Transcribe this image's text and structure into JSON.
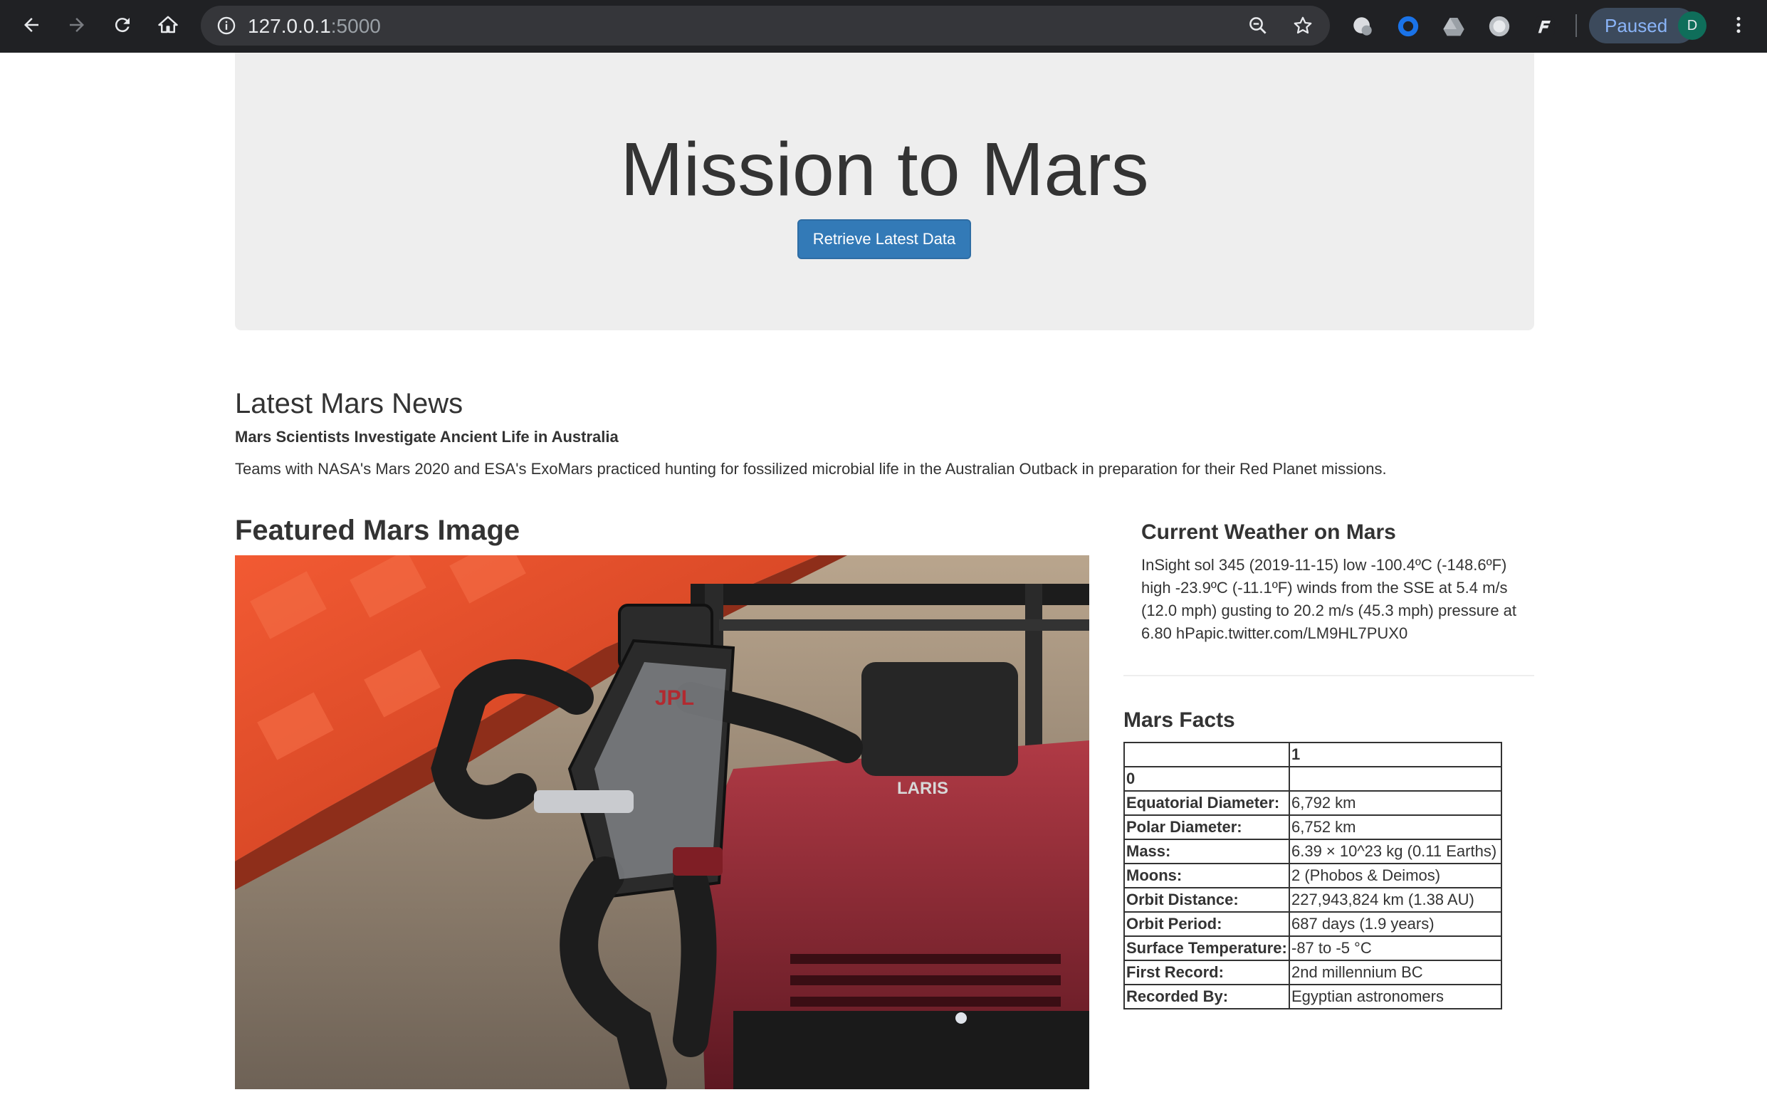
{
  "browser": {
    "url_host": "127.0.0.1",
    "url_port": ":5000",
    "profile_status": "Paused",
    "avatar_initial": "D"
  },
  "jumbotron": {
    "title": "Mission to Mars",
    "button_label": "Retrieve Latest Data"
  },
  "news": {
    "heading": "Latest Mars News",
    "title": "Mars Scientists Investigate Ancient Life in Australia",
    "paragraph": "Teams with NASA's Mars 2020 and ESA's ExoMars practiced hunting for fossilized microbial life in the Australian Outback in preparation for their Red Planet missions."
  },
  "featured": {
    "heading": "Featured Mars Image"
  },
  "weather": {
    "heading": "Current Weather on Mars",
    "text": "InSight sol 345 (2019-11-15) low -100.4ºC (-148.6ºF) high -23.9ºC (-11.1ºF) winds from the SSE at 5.4 m/s (12.0 mph) gusting to 20.2 m/s (45.3 mph) pressure at 6.80 hPapic.twitter.com/LM9HL7PUX0"
  },
  "facts": {
    "heading": "Mars Facts",
    "col_header": "1",
    "index_header": "0",
    "rows": [
      {
        "label": "Equatorial Diameter:",
        "value": "6,792 km"
      },
      {
        "label": "Polar Diameter:",
        "value": "6,752 km"
      },
      {
        "label": "Mass:",
        "value": "6.39 × 10^23 kg (0.11 Earths)"
      },
      {
        "label": "Moons:",
        "value": "2 (Phobos & Deimos)"
      },
      {
        "label": "Orbit Distance:",
        "value": "227,943,824 km (1.38 AU)"
      },
      {
        "label": "Orbit Period:",
        "value": "687 days (1.9 years)"
      },
      {
        "label": "Surface Temperature:",
        "value": "-87 to -5 °C"
      },
      {
        "label": "First Record:",
        "value": "2nd millennium BC"
      },
      {
        "label": "Recorded By:",
        "value": "Egyptian astronomers"
      }
    ]
  },
  "colors": {
    "primary_button": "#337ab7",
    "jumbotron_bg": "#eeeeee",
    "chrome_bg": "#202124"
  }
}
